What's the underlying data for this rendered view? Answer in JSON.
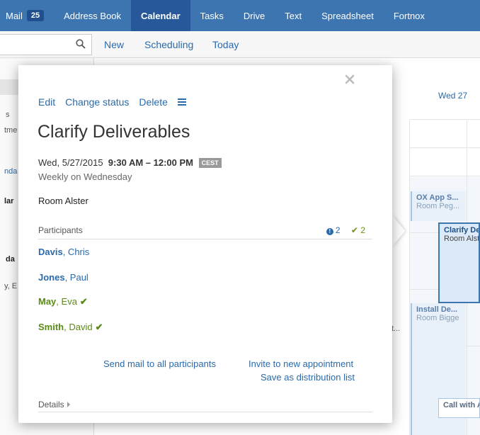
{
  "apps": [
    {
      "label": "Mail",
      "badge": "25"
    },
    {
      "label": "Address Book"
    },
    {
      "label": "Calendar",
      "active": true
    },
    {
      "label": "Tasks"
    },
    {
      "label": "Drive"
    },
    {
      "label": "Text"
    },
    {
      "label": "Spreadsheet"
    },
    {
      "label": "Fortnox"
    }
  ],
  "toolbar": {
    "new_label": "New",
    "scheduling_label": "Scheduling",
    "today_label": "Today"
  },
  "calendar": {
    "day_header": "Wed 27",
    "appointments": [
      {
        "title": "OX App S...",
        "location": "Room Peg..."
      },
      {
        "title": "Clarify De",
        "location": "Room Alst"
      },
      {
        "title": "Install De...",
        "location": "Room Bigge"
      },
      {
        "title": "Call with A",
        "location": ""
      }
    ],
    "fragments": {
      "left1": "s",
      "left2": "tme",
      "left3": "nda",
      "left4": "lar",
      "left5": "da",
      "left6": "y, E",
      "mid1": "t..."
    }
  },
  "popup": {
    "actions": {
      "edit": "Edit",
      "change_status": "Change status",
      "delete": "Delete"
    },
    "title": "Clarify Deliverables",
    "date": "Wed, 5/27/2015",
    "time": "9:30 AM – 12:00 PM",
    "timezone": "CEST",
    "recurrence": "Weekly on Wednesday",
    "location": "Room Alster",
    "participants_label": "Participants",
    "count_unknown": "2",
    "count_accepted": "2",
    "participants": [
      {
        "last": "Davis",
        "first": ", Chris",
        "status": "unknown"
      },
      {
        "last": "Jones",
        "first": ", Paul",
        "status": "unknown"
      },
      {
        "last": "May",
        "first": ", Eva",
        "status": "accepted"
      },
      {
        "last": "Smith",
        "first": ", David",
        "status": "accepted"
      }
    ],
    "send_mail": "Send mail to all participants",
    "invite": "Invite to new appointment",
    "save_list": "Save as distribution list",
    "details_label": "Details"
  },
  "colors": {
    "brand": "#3d75b1",
    "link": "#2a6aab",
    "accepted": "#5b8a18"
  }
}
